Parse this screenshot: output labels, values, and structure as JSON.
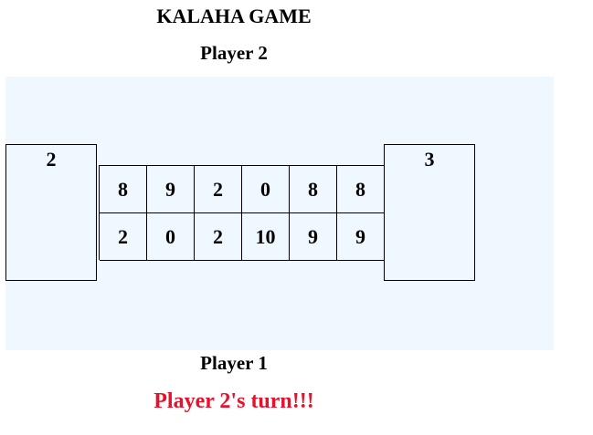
{
  "title": "KALAHA GAME",
  "player2_label": "Player 2",
  "player1_label": "Player 1",
  "turn_message": "Player 2's turn!!!",
  "turn_color": "#e8102a",
  "board_background": "#f0f8ff",
  "stores": {
    "left": "2",
    "right": "3"
  },
  "pits": {
    "top": [
      "8",
      "9",
      "2",
      "0",
      "8",
      "8"
    ],
    "bottom": [
      "2",
      "0",
      "2",
      "10",
      "9",
      "9"
    ]
  }
}
